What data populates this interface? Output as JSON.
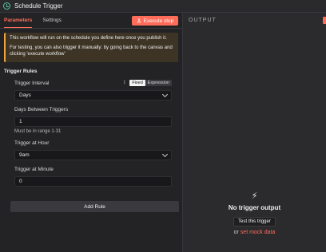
{
  "window": {
    "title": "Schedule Trigger"
  },
  "tabs": [
    {
      "label": "Parameters",
      "active": true
    },
    {
      "label": "Settings",
      "active": false
    }
  ],
  "execute_step": {
    "label": "Execute step",
    "icon": "flask-icon",
    "color": "#ff6d5a"
  },
  "notice": {
    "line1": "This workflow will run on the schedule you define here once you publish it.",
    "line2": "For testing, you can also trigger it manually: by going back to the canvas and clicking 'execute workflow'"
  },
  "section": {
    "title": "Trigger Rules"
  },
  "fields": {
    "interval": {
      "label": "Trigger Interval",
      "value": "Days",
      "mode_fixed": "Fixed",
      "mode_expression": "Expression"
    },
    "days_between": {
      "label": "Days Between Triggers",
      "value": "1",
      "hint": "Must be in range 1-31"
    },
    "hour": {
      "label": "Trigger at Hour",
      "value": "9am"
    },
    "minute": {
      "label": "Trigger at Minute",
      "value": "0"
    }
  },
  "add_rule": {
    "label": "Add Rule"
  },
  "output": {
    "header": "OUTPUT",
    "empty_title": "No trigger output",
    "test_button": "Test this trigger",
    "or_text": "or",
    "mock_link": "set mock data"
  }
}
